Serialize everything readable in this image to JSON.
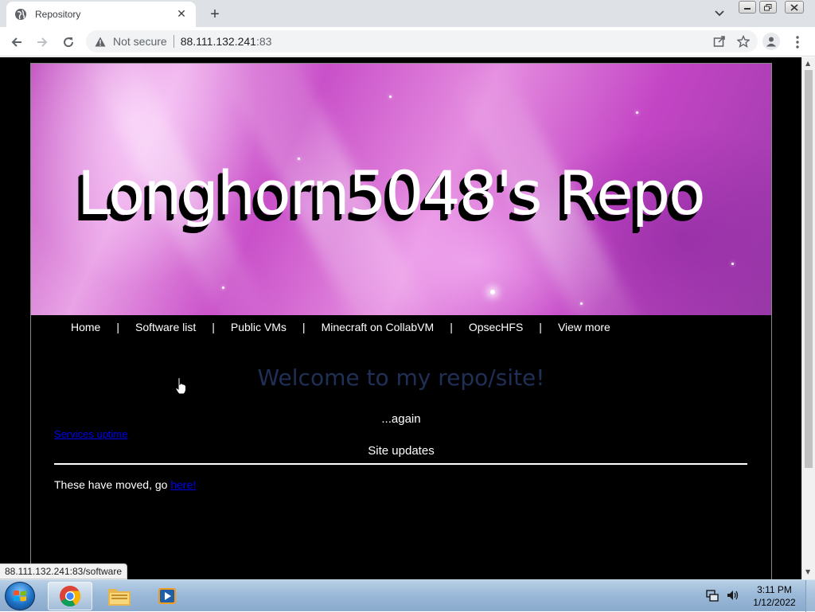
{
  "browser": {
    "tab_title": "Repository",
    "new_tab_glyph": "+",
    "url_warning": "Not secure",
    "url_host": "88.111.132.241",
    "url_port": ":83"
  },
  "page": {
    "banner_title": "Longhorn5048's Repo",
    "nav": [
      {
        "label": "Home"
      },
      {
        "label": "Software list"
      },
      {
        "label": "Public VMs"
      },
      {
        "label": "Minecraft on CollabVM"
      },
      {
        "label": "OpsecHFS"
      },
      {
        "label": "View more"
      }
    ],
    "nav_separator": "|",
    "welcome": "Welcome to my repo/site!",
    "again": "...again",
    "services_link": "Services uptime",
    "updates_heading": "Site updates",
    "moved_text": "These have moved, go ",
    "moved_link": "here!"
  },
  "status_url": "88.111.132.241:83/software",
  "taskbar": {
    "time": "3:11 PM",
    "date": "1/12/2022"
  },
  "colors": {
    "welcome": "#1f2f55",
    "link": "#0000ee"
  }
}
